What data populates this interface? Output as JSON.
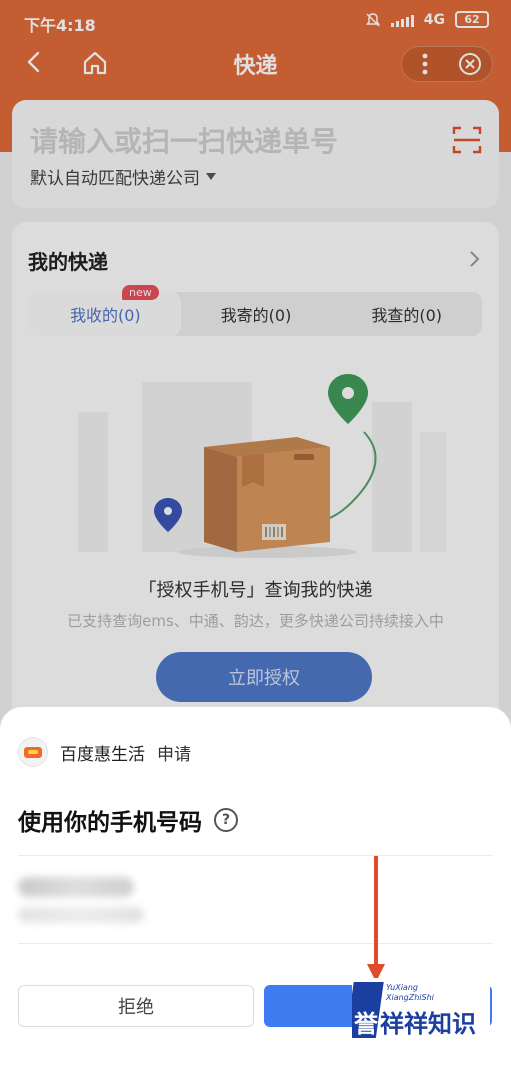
{
  "status": {
    "time": "下午4:18",
    "network": "4G",
    "battery": "62"
  },
  "nav": {
    "title": "快递"
  },
  "search": {
    "placeholder": "请输入或扫一扫快递单号",
    "company": "默认自动匹配快递公司"
  },
  "express": {
    "heading": "我的快递",
    "tabs": [
      {
        "label": "我收的(0)",
        "badge": "new"
      },
      {
        "label": "我寄的(0)"
      },
      {
        "label": "我查的(0)"
      }
    ],
    "auth_title": "「授权手机号」查询我的快递",
    "auth_sub": "已支持查询ems、中通、韵达，更多快递公司持续接入中",
    "auth_button": "立即授权"
  },
  "sheet": {
    "app_name": "百度惠生活",
    "apply": "申请",
    "title": "使用你的手机号码",
    "reject": "拒绝"
  },
  "watermark": {
    "en1": "YuXiang",
    "en2": "XiangZhiShi",
    "cn": "誉祥祥知识"
  },
  "colors": {
    "header": "#e06a38",
    "primary": "#3f7cf1",
    "accent_red": "#e04b2a"
  }
}
